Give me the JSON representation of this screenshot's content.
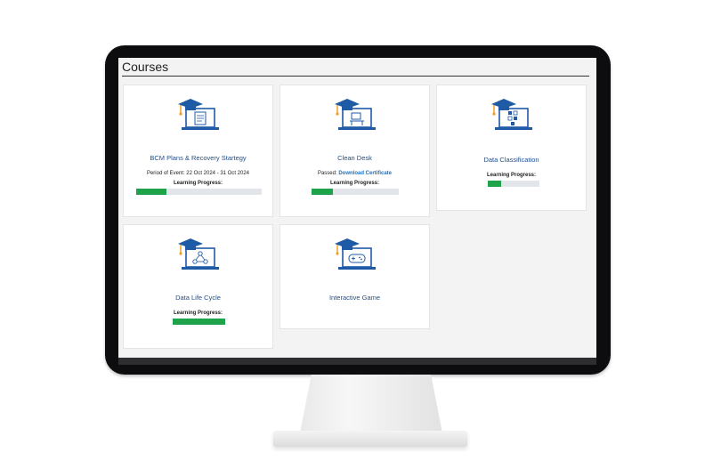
{
  "page": {
    "title": "Courses"
  },
  "courses": [
    {
      "title": "BCM Plans & Recovery Startegy",
      "period": "Period of Event: 22 Oct 2024 - 31 Oct 2024",
      "progress_label": "Learning Progress:",
      "progress": 0.24,
      "icon": "document-laptop-icon"
    },
    {
      "title": "Clean Desk",
      "passed_label": "Passed: ",
      "certificate_link": "Download Certificate",
      "progress_label": "Learning Progress:",
      "progress": 0.24,
      "icon": "desk-laptop-icon"
    },
    {
      "title": "Data Classification",
      "progress_label": "Learning Progress:",
      "progress": 0.25,
      "icon": "data-classification-laptop-icon"
    },
    {
      "title": "Data Life Cycle",
      "progress_label": "Learning Progress:",
      "progress": 1.0,
      "icon": "lifecycle-laptop-icon"
    },
    {
      "title": "Interactive Game",
      "icon": "gamepad-laptop-icon"
    }
  ],
  "colors": {
    "accent_blue": "#1f5aa6",
    "progress_green": "#1fa34a",
    "link_blue": "#1a72c9"
  }
}
